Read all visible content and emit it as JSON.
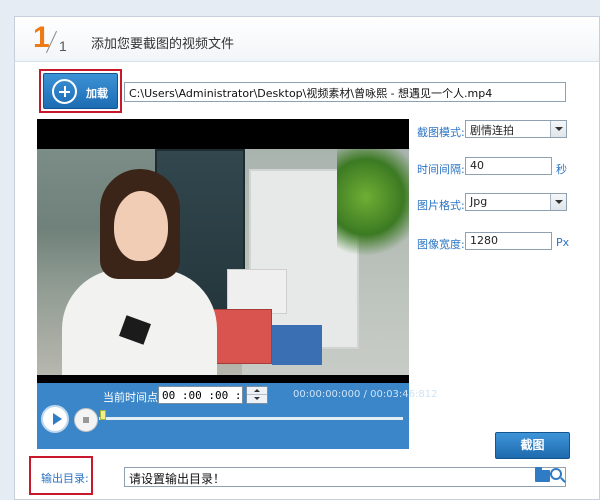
{
  "step": {
    "number": "1",
    "total": "1",
    "title": "添加您要截图的视频文件"
  },
  "load": {
    "label": "加载",
    "icon": "plus-circle-icon"
  },
  "file": {
    "path": "C:\\Users\\Administrator\\Desktop\\视频素材\\曾咏熙 - 想遇见一个人.mp4"
  },
  "player": {
    "current_time_label": "当前时间点:",
    "current_time_value": "00 :00 :00 :000",
    "time_display": "00:00:00:000 / 00:03:46:812",
    "progress": 0.0
  },
  "settings": {
    "mode": {
      "label": "截图模式:",
      "value": "剧情连拍"
    },
    "interval": {
      "label": "时间间隔:",
      "value": "40",
      "unit": "秒"
    },
    "format": {
      "label": "图片格式:",
      "value": "Jpg"
    },
    "width": {
      "label": "图像宽度:",
      "value": "1280",
      "unit": "Px"
    }
  },
  "actions": {
    "capture_label": "截图"
  },
  "output": {
    "label": "输出目录:",
    "value": "请设置输出目录！"
  },
  "colors": {
    "accent_blue": "#2b74c4",
    "step_orange": "#ee7a16",
    "highlight_red": "#c8192c",
    "control_bar": "#3a86c8"
  }
}
